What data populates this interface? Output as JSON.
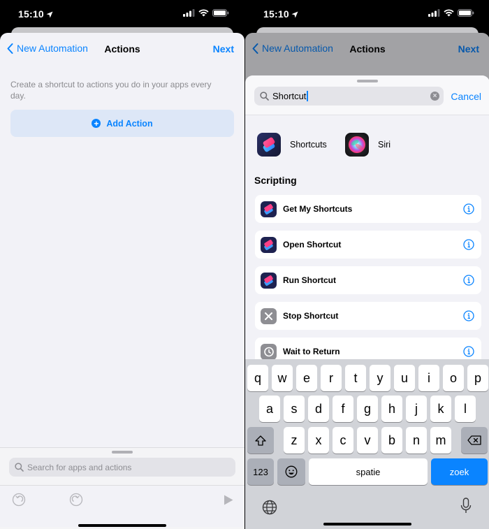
{
  "status": {
    "time": "15:10"
  },
  "left": {
    "nav": {
      "back_label": "New Automation",
      "title": "Actions",
      "next_label": "Next"
    },
    "hint": "Create a shortcut to actions you do in your apps every day.",
    "add_action_label": "Add Action",
    "search_placeholder": "Search for apps and actions"
  },
  "right": {
    "nav": {
      "back_label": "New Automation",
      "title": "Actions",
      "next_label": "Next"
    },
    "search": {
      "value": "Shortcut",
      "cancel_label": "Cancel"
    },
    "apps": [
      {
        "label": "Shortcuts",
        "icon": "shortcuts-app-icon"
      },
      {
        "label": "Siri",
        "icon": "siri-app-icon"
      }
    ],
    "section_title": "Scripting",
    "actions": [
      {
        "label": "Get My Shortcuts",
        "icon": "shortcuts-icon"
      },
      {
        "label": "Open Shortcut",
        "icon": "shortcuts-icon"
      },
      {
        "label": "Run Shortcut",
        "icon": "shortcuts-icon"
      },
      {
        "label": "Stop Shortcut",
        "icon": "stop-x-icon"
      },
      {
        "label": "Wait to Return",
        "icon": "clock-history-icon"
      }
    ],
    "keyboard": {
      "row1": [
        "q",
        "w",
        "e",
        "r",
        "t",
        "y",
        "u",
        "i",
        "o",
        "p"
      ],
      "row2": [
        "a",
        "s",
        "d",
        "f",
        "g",
        "h",
        "j",
        "k",
        "l"
      ],
      "row3": [
        "z",
        "x",
        "c",
        "v",
        "b",
        "n",
        "m"
      ],
      "numbers_label": "123",
      "space_label": "spatie",
      "go_label": "zoek"
    }
  },
  "colors": {
    "accent": "#0a84ff",
    "background": "#f2f2f7",
    "keyboard": "#d1d3d8"
  }
}
